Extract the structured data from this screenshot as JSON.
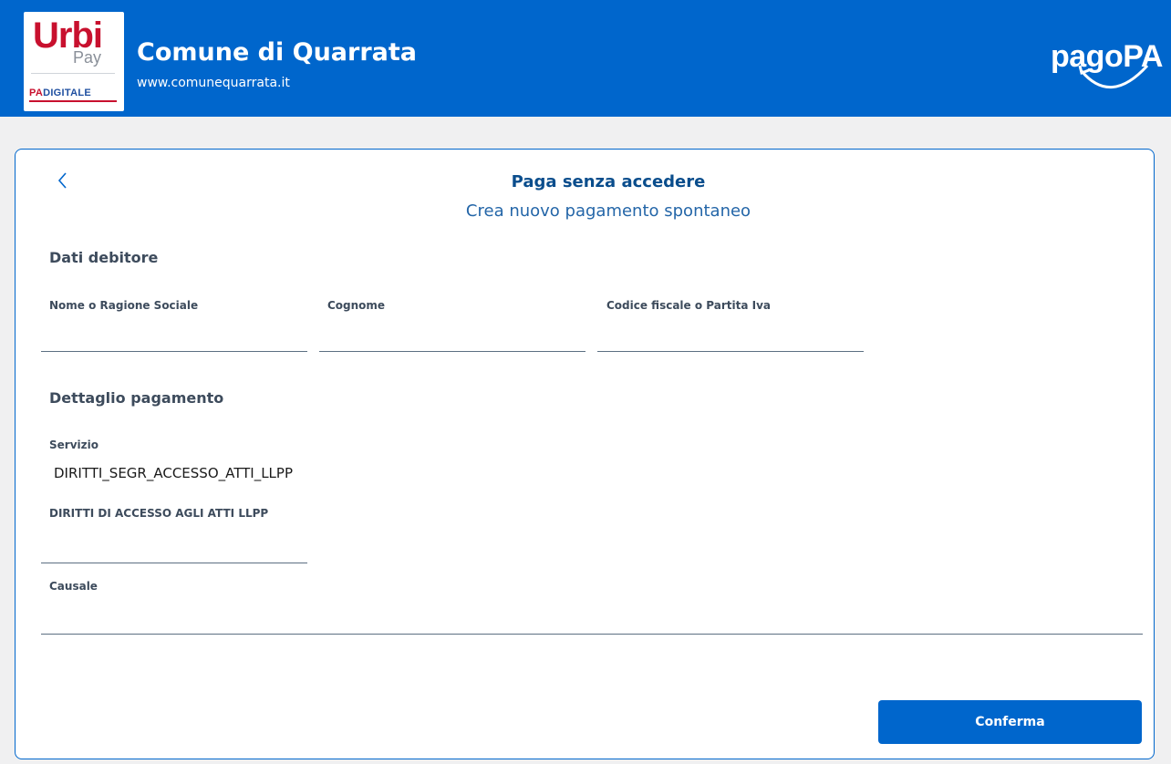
{
  "header": {
    "logo": {
      "urbi": "Urbi",
      "pay": "Pay",
      "pa": "PA",
      "digitale": "DIGITALE"
    },
    "title": "Comune di Quarrata",
    "url": "www.comunequarrata.it",
    "pagopa_logo": "pagoPA"
  },
  "card": {
    "back_icon": "chevron-left-icon",
    "title": "Paga senza accedere",
    "subtitle": "Crea nuovo pagamento spontaneo",
    "debtor": {
      "section_title": "Dati debitore",
      "name_label": "Nome o Ragione Sociale",
      "name_value": "",
      "surname_label": "Cognome",
      "surname_value": "",
      "tax_code_label": "Codice fiscale o Partita Iva",
      "tax_code_value": ""
    },
    "payment": {
      "section_title": "Dettaglio pagamento",
      "service_label": "Servizio",
      "service_value": "DIRITTI_SEGR_ACCESSO_ATTI_LLPP",
      "amount_label": "DIRITTI DI ACCESSO AGLI ATTI LLPP",
      "amount_value": "",
      "reason_label": "Causale",
      "reason_value": ""
    },
    "confirm_label": "Conferma"
  },
  "colors": {
    "brand_blue": "#0066cc",
    "title_blue": "#0a4d8c",
    "text_gray": "#3d4b5c",
    "background": "#f0f0f1"
  }
}
